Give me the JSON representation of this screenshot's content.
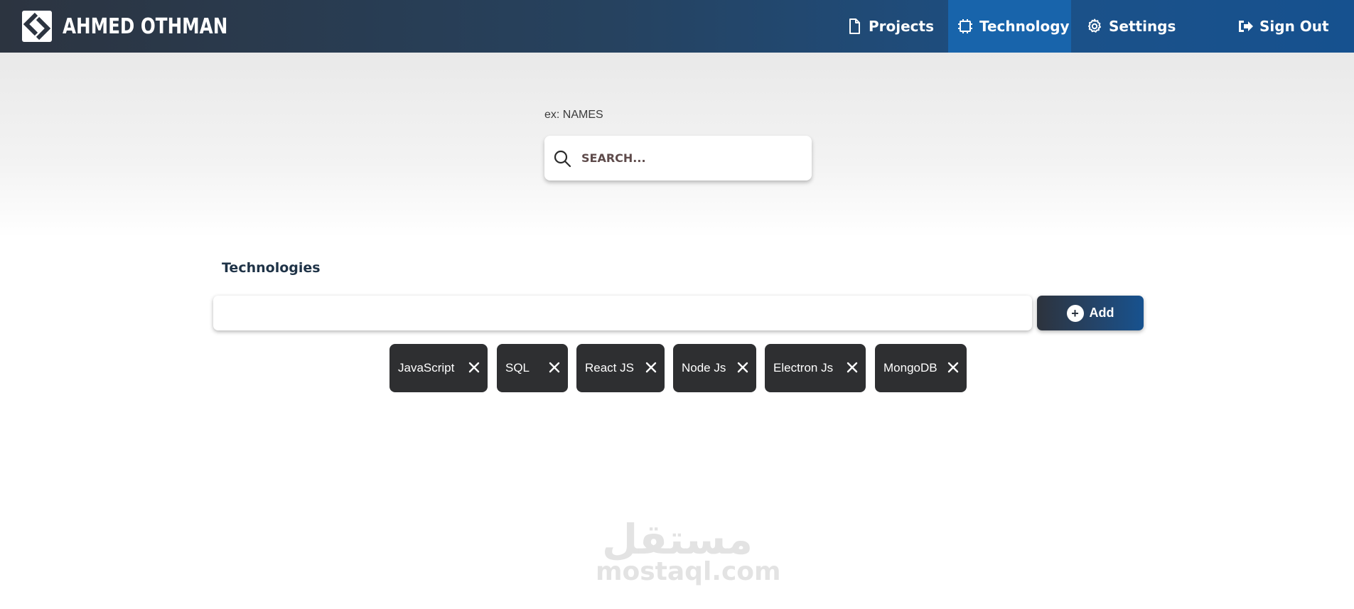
{
  "header": {
    "brand_name": "AHMED OTHMAN",
    "nav": [
      {
        "label": "Projects",
        "icon": "file-icon"
      },
      {
        "label": "Technology",
        "icon": "chip-icon",
        "active": true
      },
      {
        "label": "Settings",
        "icon": "gear-icon"
      },
      {
        "label": "Sign Out",
        "icon": "sign-out-icon"
      }
    ],
    "colors": {
      "active_tab": "#1864ab",
      "gradient_start": "#2c3440",
      "gradient_end": "#16518f"
    }
  },
  "search": {
    "hint": "ex:  NAMES",
    "placeholder": "SEARCH..."
  },
  "technologies": {
    "title": "Technologies",
    "input_value": "",
    "add_label": "Add",
    "chips": [
      "JavaScript",
      "SQL",
      "React JS",
      "Node Js",
      "Electron Js",
      "MongoDB"
    ]
  },
  "watermark": {
    "arabic": "مستقل",
    "latin": "mostaql.com"
  }
}
